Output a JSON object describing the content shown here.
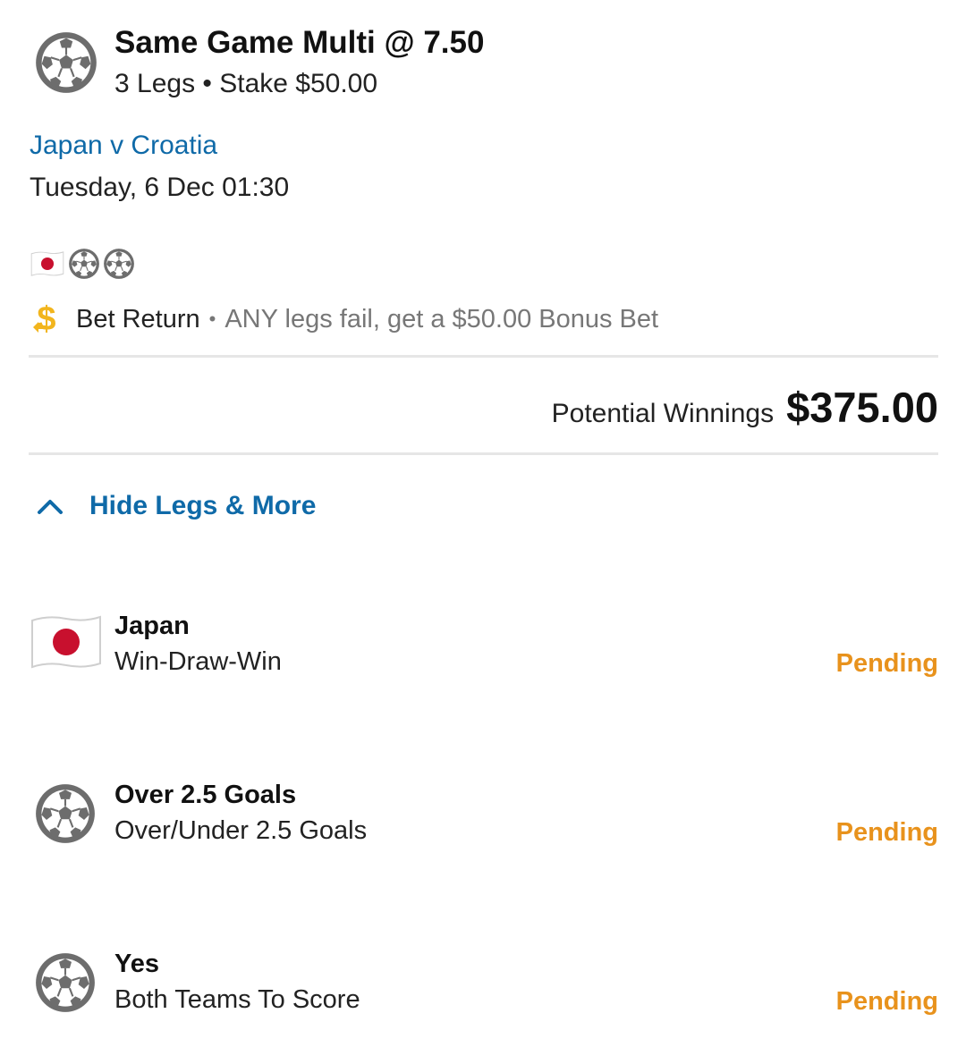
{
  "bet": {
    "title": "Same Game Multi @ 7.50",
    "subtitle": "3 Legs • Stake $50.00",
    "sport_icon": "soccer-ball-icon"
  },
  "match": {
    "name": "Japan v Croatia",
    "datetime": "Tuesday, 6 Dec 01:30"
  },
  "leg_icons": [
    "japan-flag-icon",
    "soccer-ball-icon",
    "soccer-ball-icon"
  ],
  "promo": {
    "icon": "dollar-return-icon",
    "title": "Bet Return",
    "separator": "•",
    "description": "ANY legs fail, get a $50.00 Bonus Bet"
  },
  "winnings": {
    "label": "Potential Winnings",
    "amount": "$375.00"
  },
  "toggle": {
    "label": "Hide Legs & More",
    "icon": "chevron-up-icon"
  },
  "legs": [
    {
      "icon": "japan-flag-icon",
      "selection": "Japan",
      "market": "Win-Draw-Win",
      "status": "Pending"
    },
    {
      "icon": "soccer-ball-icon",
      "selection": "Over 2.5 Goals",
      "market": "Over/Under 2.5 Goals",
      "status": "Pending"
    },
    {
      "icon": "soccer-ball-icon",
      "selection": "Yes",
      "market": "Both Teams To Score",
      "status": "Pending"
    }
  ],
  "colors": {
    "link_blue": "#0f6aa8",
    "pending_orange": "#e8921c",
    "icon_gray": "#6d6d6d",
    "promo_gold": "#f2b51d",
    "flag_red": "#c8102e"
  }
}
